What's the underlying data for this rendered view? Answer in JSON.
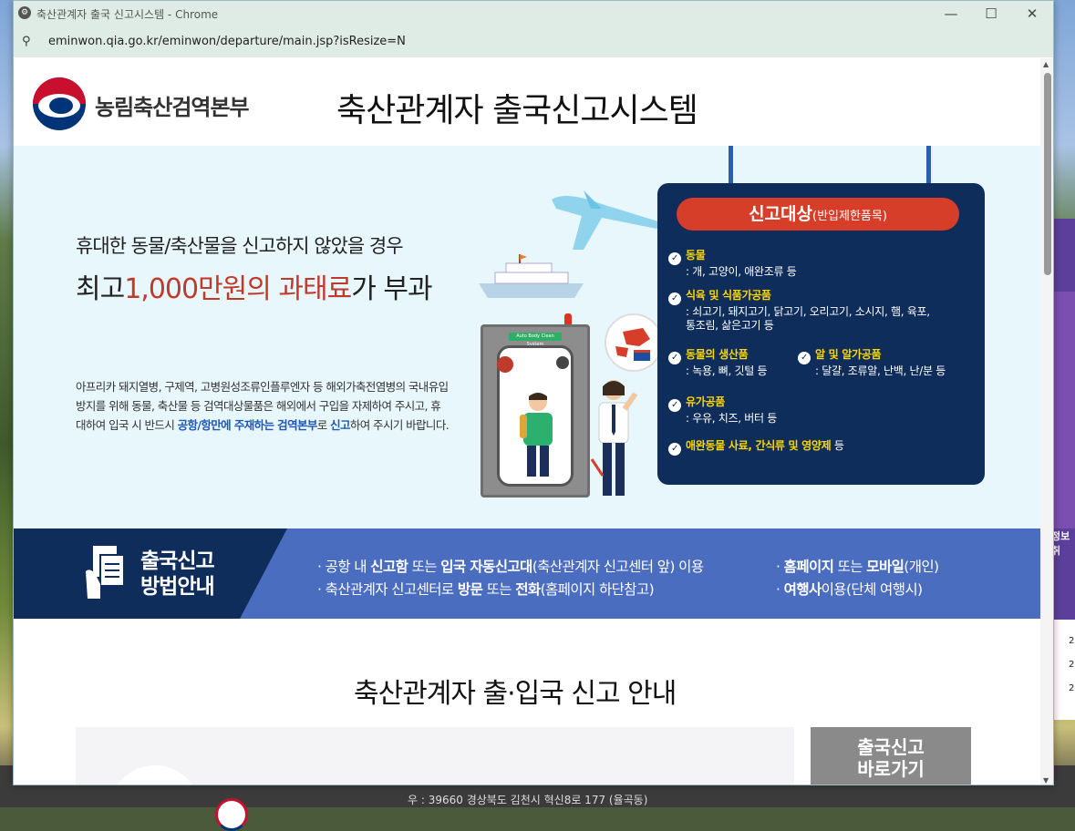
{
  "window": {
    "title": "축산관계자 출국 신고시스템 - Chrome",
    "url": "eminwon.qia.go.kr/eminwon/departure/main.jsp?isResize=N"
  },
  "header": {
    "org_name": "농림축산검역본부",
    "site_title": "축산관계자 출국신고시스템"
  },
  "hero": {
    "line1": "휴대한 동물/축산물을 신고하지 않았을 경우",
    "line2_pre": "최고",
    "line2_red": "1,000만원의 과태료",
    "line2_post": "가 부과",
    "desc_1": "아프리카 돼지열병, 구제역, 고병원성조류인플루엔자 등 해외가축전염병의 국내유입 방지를 위해 동물, 축산물 등 검역대상물품은 해외에서 구입을 자제하여 주시고, 휴대하여 입국 시 반드시 ",
    "desc_hl1": "공항/항만에 주재하는 검역본부",
    "desc_2": "로 ",
    "desc_hl2": "신고",
    "desc_3": "하여 주시기 바랍니다.",
    "booth_sign": "Auto Body Clean System"
  },
  "board": {
    "title": "신고대상",
    "subtitle": "(반입제한품목)",
    "items": [
      {
        "title": "동물",
        "desc": ": 개, 고양이, 애완조류 등"
      },
      {
        "title": "식육 및 식품가공품",
        "desc": ": 쇠고기, 돼지고기, 닭고기, 오리고기, 소시지, 햄, 육포,",
        "desc2": "통조림, 삶은고기 등"
      },
      {
        "title": "동물의 생산품",
        "desc": ": 녹용, 뼈, 깃털 등"
      },
      {
        "title": "알 및 알가공품",
        "desc": ": 달걀, 조류알, 난백, 난/분 등"
      },
      {
        "title": "유가공품",
        "desc": ": 우유, 치즈, 버터 등"
      },
      {
        "title": "애완동물 사료, 간식류 및 영양제",
        "suffix": " 등"
      }
    ]
  },
  "guide": {
    "title_line1": "출국신고",
    "title_line2": "방법안내",
    "l1_a": "· 공항 내 ",
    "l1_b": "신고함",
    "l1_c": " 또는 ",
    "l1_d": "입국 자동신고대",
    "l1_e": "(축산관계자 신고센터 앞) 이용",
    "l2_a": "· 축산관계자 신고센터로 ",
    "l2_b": "방문",
    "l2_c": " 또는 ",
    "l2_d": "전화",
    "l2_e": "(홈페이지 하단참고)",
    "r1_a": "· ",
    "r1_b": "홈페이지",
    "r1_c": " 또는 ",
    "r1_d": "모바일",
    "r1_e": "(개인)",
    "r2_a": "· ",
    "r2_b": "여행사",
    "r2_c": "이용(단체 여행시)"
  },
  "section2": {
    "title": "축산관계자 출·입국 신고 안내",
    "btn_line1": "출국신고",
    "btn_line2": "바로가기"
  },
  "footer": {
    "address": "우 : 39660 경상북도 김천시 혁신8로 177 (율곡동)"
  },
  "background": {
    "side_text": "정보취",
    "side_nums": [
      "2",
      "2",
      "2"
    ]
  }
}
